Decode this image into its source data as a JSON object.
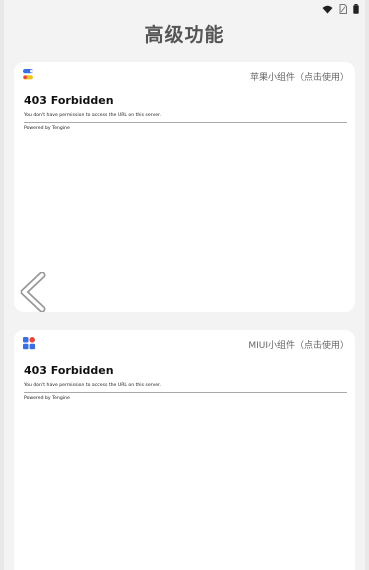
{
  "status_bar": {
    "icons": [
      "wifi-icon",
      "sim-icon",
      "battery-icon"
    ]
  },
  "page": {
    "title": "高级功能"
  },
  "cards": [
    {
      "label": "苹果小组件（点击使用）",
      "icon": "apple-widget-icon",
      "web": {
        "heading": "403 Forbidden",
        "message": "You don't have permission to access the URL on this server.",
        "footer": "Powered by Tengine"
      }
    },
    {
      "label": "MIUI小组件（点击使用）",
      "icon": "miui-widget-icon",
      "web": {
        "heading": "403 Forbidden",
        "message": "You don't have permission to access the URL on this server.",
        "footer": "Powered by Tengine"
      }
    }
  ],
  "navigation": {
    "back_icon": "chevron-left-icon"
  },
  "colors": {
    "background": "#f3f3f3",
    "card": "#ffffff",
    "title": "#555555",
    "widget_blue": "#3a6fe0",
    "widget_yellow": "#f4c21b",
    "widget_red": "#e8453c"
  }
}
